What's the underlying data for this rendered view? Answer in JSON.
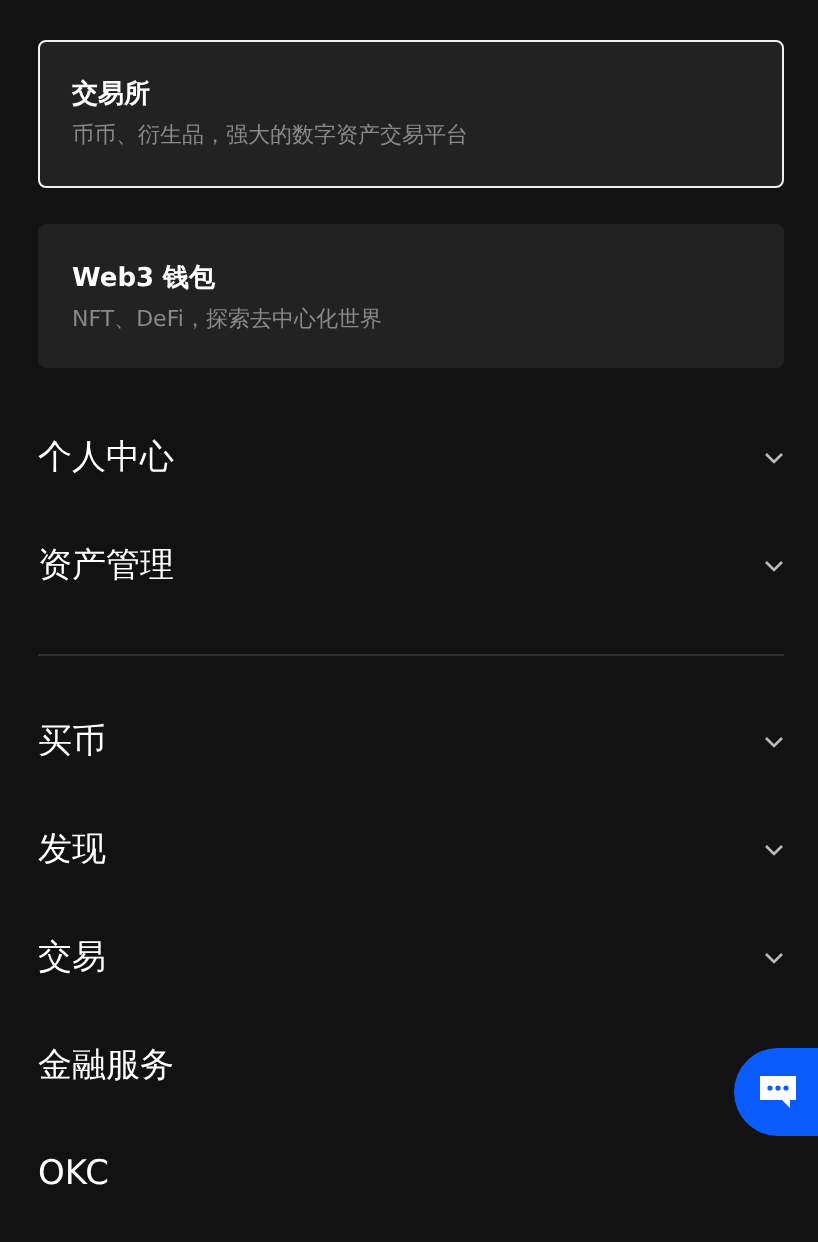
{
  "products": [
    {
      "title": "交易所",
      "subtitle": "币币、衍生品，强大的数字资产交易平台",
      "selected": true
    },
    {
      "title": "Web3 钱包",
      "subtitle": "NFT、DeFi，探索去中心化世界",
      "selected": false
    }
  ],
  "menu_sections": [
    [
      {
        "label": "个人中心",
        "kind": "group",
        "expanded": false
      },
      {
        "label": "资产管理",
        "kind": "group",
        "expanded": false
      }
    ],
    [
      {
        "label": "买币",
        "kind": "group",
        "expanded": false
      },
      {
        "label": "发现",
        "kind": "group",
        "expanded": false
      },
      {
        "label": "交易",
        "kind": "group",
        "expanded": false
      },
      {
        "label": "金融服务",
        "kind": "link"
      },
      {
        "label": "OKC",
        "kind": "link"
      }
    ]
  ],
  "chat_button": {
    "kind": "chat"
  }
}
